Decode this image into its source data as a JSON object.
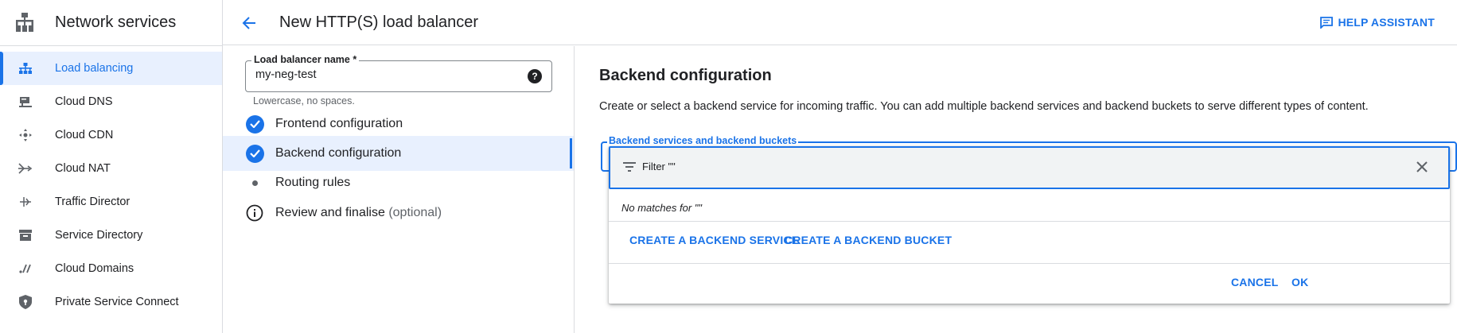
{
  "leftnav": {
    "product_title": "Network services",
    "product_icon": "network-services-icon",
    "items": [
      {
        "label": "Load balancing",
        "icon": "load-balancing-icon",
        "active": true
      },
      {
        "label": "Cloud DNS",
        "icon": "cloud-dns-icon"
      },
      {
        "label": "Cloud CDN",
        "icon": "cloud-cdn-icon"
      },
      {
        "label": "Cloud NAT",
        "icon": "cloud-nat-icon"
      },
      {
        "label": "Traffic Director",
        "icon": "traffic-director-icon"
      },
      {
        "label": "Service Directory",
        "icon": "service-directory-icon"
      },
      {
        "label": "Cloud Domains",
        "icon": "cloud-domains-icon"
      },
      {
        "label": "Private Service Connect",
        "icon": "private-service-connect-icon"
      }
    ]
  },
  "header": {
    "title": "New HTTP(S) load balancer",
    "help_assistant": "HELP ASSISTANT"
  },
  "form": {
    "name_label": "Load balancer name *",
    "name_value": "my-neg-test",
    "name_hint": "Lowercase, no spaces."
  },
  "steps": [
    {
      "label": "Frontend configuration",
      "status": "complete"
    },
    {
      "label": "Backend configuration",
      "status": "complete",
      "active": true
    },
    {
      "label": "Routing rules",
      "status": "pending"
    },
    {
      "label": "Review and finalise",
      "optional": "(optional)",
      "status": "info"
    }
  ],
  "backend": {
    "title": "Backend configuration",
    "description": "Create or select a backend service for incoming traffic. You can add multiple backend services and backend buckets to serve different types of content.",
    "select_label": "Backend services and backend buckets",
    "filter_text": "Filter \"\"",
    "no_matches": "No matches for \"\"",
    "create_service": "CREATE A BACKEND SERVICE",
    "create_bucket": "CREATE A BACKEND BUCKET",
    "cancel": "CANCEL",
    "ok": "OK"
  },
  "colors": {
    "accent": "#1a73e8",
    "active_bg": "#e8f0fe",
    "divider": "#dadce0"
  }
}
